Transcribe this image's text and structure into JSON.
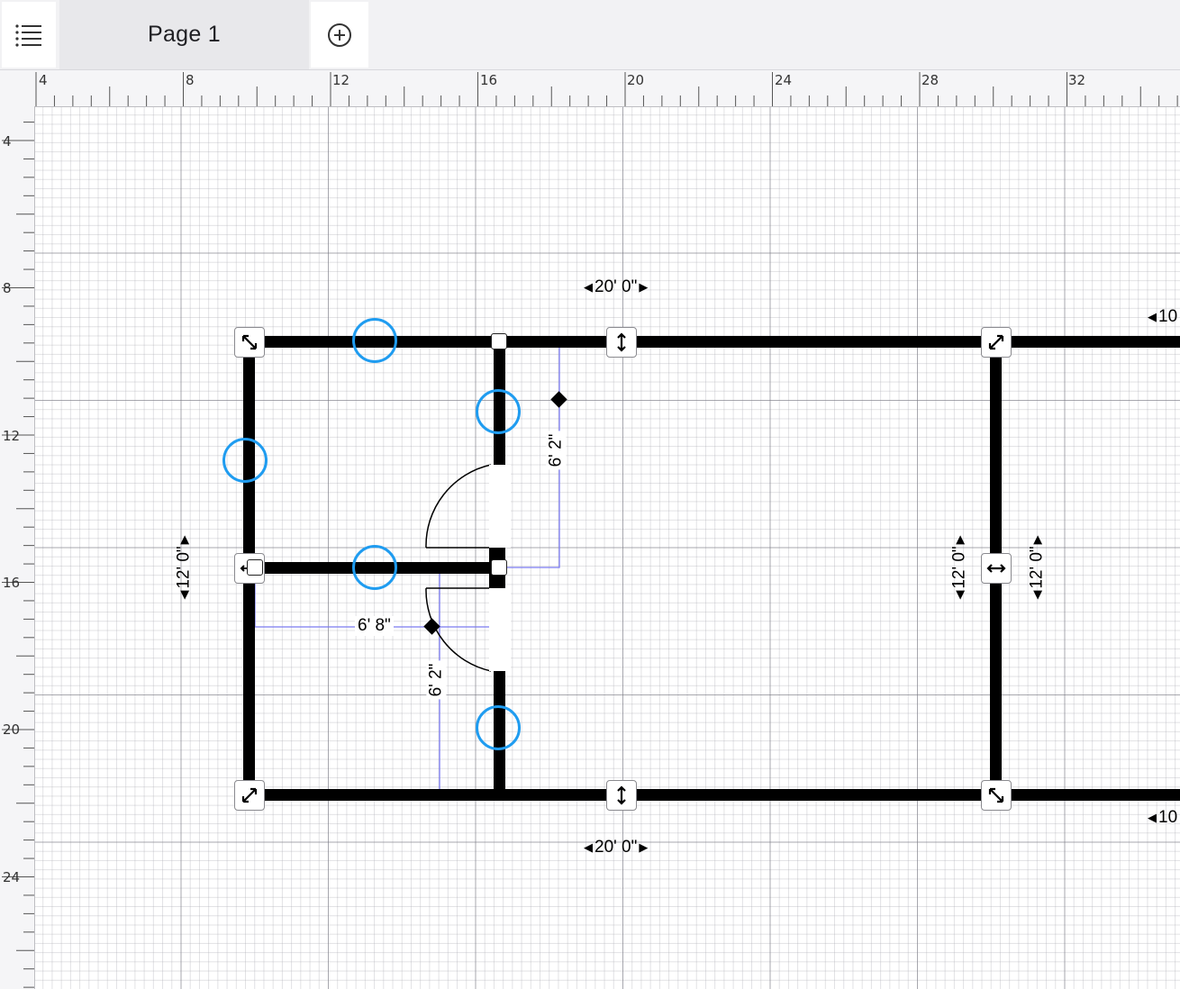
{
  "tabs": {
    "menu_icon": "list-icon",
    "page_label": "Page 1",
    "add_icon": "plus-circle-icon"
  },
  "ruler_top": {
    "labels": [
      "4",
      "8",
      "12",
      "16",
      "20",
      "24",
      "28",
      "32"
    ]
  },
  "ruler_left": {
    "labels": [
      "4",
      "8",
      "12",
      "16",
      "20",
      "24"
    ]
  },
  "dimensions": {
    "top_width": "20' 0\"",
    "bottom_width": "20' 0\"",
    "left_height": "12' 0\"",
    "right_inner_height": "12' 0\"",
    "right_outer_height": "12' 0\"",
    "right_top_cut": "10",
    "right_bottom_cut": "10",
    "door_upper": "6' 2\"",
    "door_lower": "6' 2\"",
    "partition_width": "6' 8\""
  },
  "colors": {
    "wall": "#000000",
    "highlight": "#1f9cf0",
    "measure_line": "#7b7bf0",
    "grid": "#aaaab2"
  }
}
